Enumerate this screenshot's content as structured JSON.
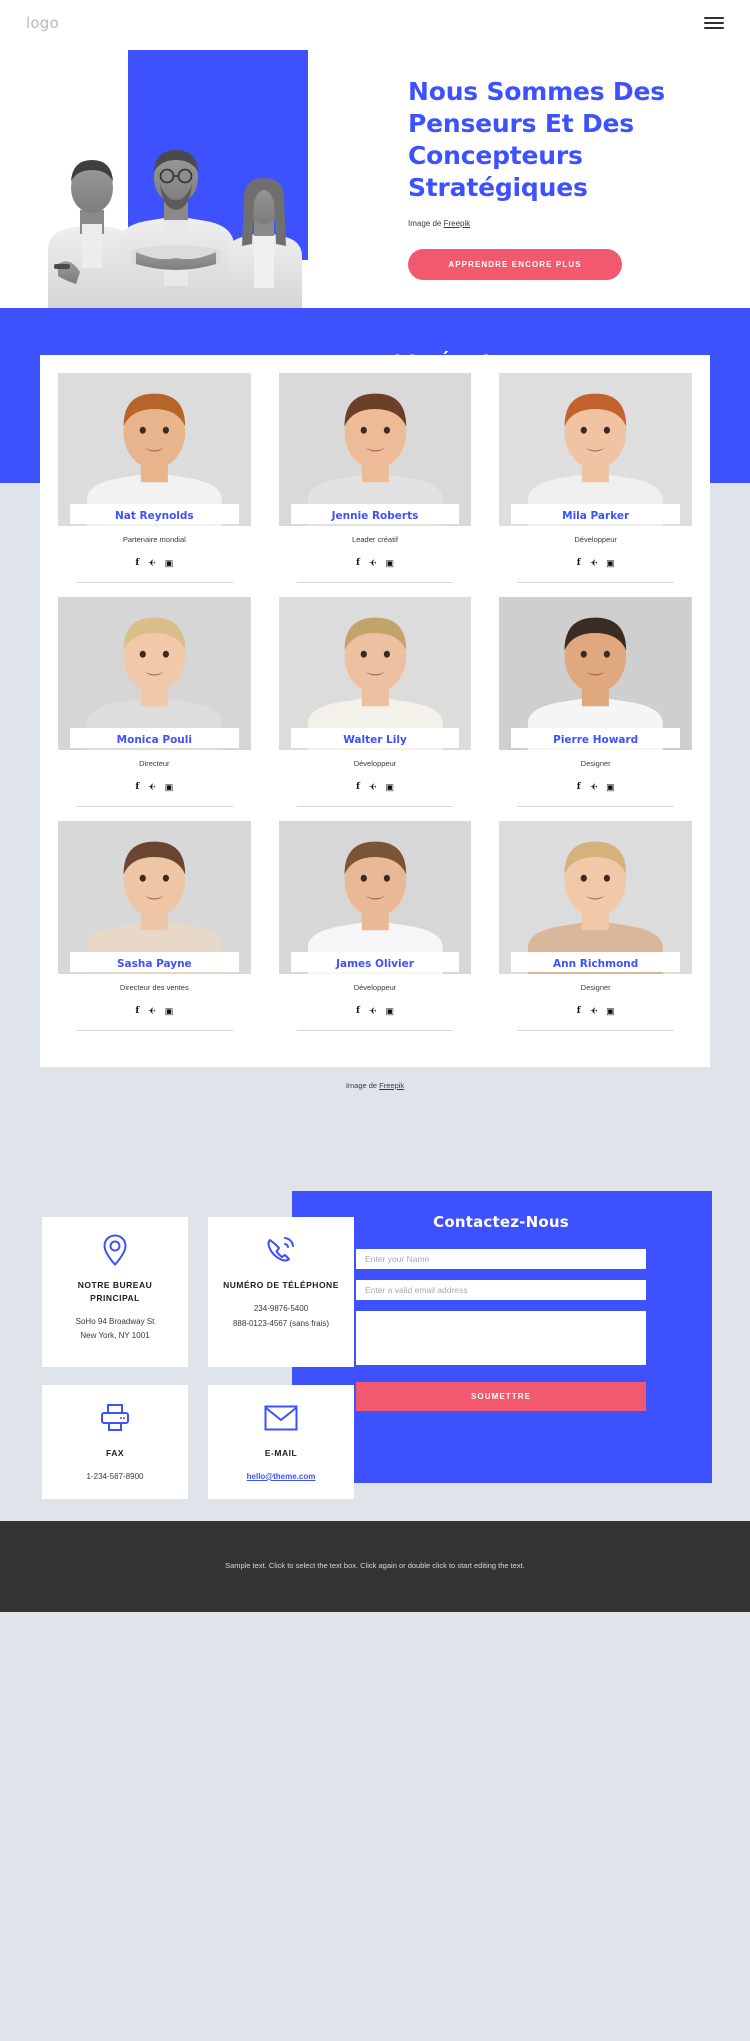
{
  "header": {
    "logo": "logo",
    "menu_icon": "hamburger-icon"
  },
  "hero": {
    "title": "Nous Sommes Des Penseurs Et Des Concepteurs Stratégiques",
    "credit_prefix": "Image de ",
    "credit_link": "Freepik",
    "cta_label": "APPRENDRE ENCORE PLUS",
    "accent_color": "#3d51ff",
    "cta_color": "#f2596f"
  },
  "team": {
    "heading": "Notre Incroyable Équipe",
    "credit_prefix": "Image de ",
    "credit_link": "Freepik",
    "social_icons": [
      "facebook-icon",
      "twitter-icon",
      "instagram-icon"
    ],
    "members": [
      {
        "name": "Nat Reynolds",
        "role": "Partenaire mondial"
      },
      {
        "name": "Jennie Roberts",
        "role": "Leader créatif"
      },
      {
        "name": "Mila Parker",
        "role": "Développeur"
      },
      {
        "name": "Monica Pouli",
        "role": "Directeur"
      },
      {
        "name": "Walter Lily",
        "role": "Développeur"
      },
      {
        "name": "Pierre Howard",
        "role": "Designer"
      },
      {
        "name": "Sasha Payne",
        "role": "Directeur des ventes"
      },
      {
        "name": "James Olivier",
        "role": "Développeur"
      },
      {
        "name": "Ann Richmond",
        "role": "Designer"
      }
    ]
  },
  "contact": {
    "cards": [
      {
        "icon": "location-pin-icon",
        "title": "NOTRE BUREAU PRINCIPAL",
        "line1": "SoHo 94 Broadway St",
        "line2": "New York, NY 1001"
      },
      {
        "icon": "phone-icon",
        "title": "NUMÉRO DE TÉLÉPHONE",
        "line1": "234-9876-5400",
        "line2": "888-0123-4567 (sans frais)"
      },
      {
        "icon": "printer-icon",
        "title": "FAX",
        "line1": "1-234-567-8900",
        "line2": ""
      },
      {
        "icon": "envelope-icon",
        "title": "E-MAIL",
        "line1": "hello@theme.com",
        "line2": ""
      }
    ],
    "form": {
      "title": "Contactez-Nous",
      "name_placeholder": "Enter your Name",
      "name_value": "",
      "email_placeholder": "Enter a valid email address",
      "email_value": "",
      "message_placeholder": "",
      "message_value": "",
      "submit_label": "SOUMETTRE"
    }
  },
  "footer": {
    "text": "Sample text. Click to select the text box. Click again or double click to start editing the text."
  }
}
